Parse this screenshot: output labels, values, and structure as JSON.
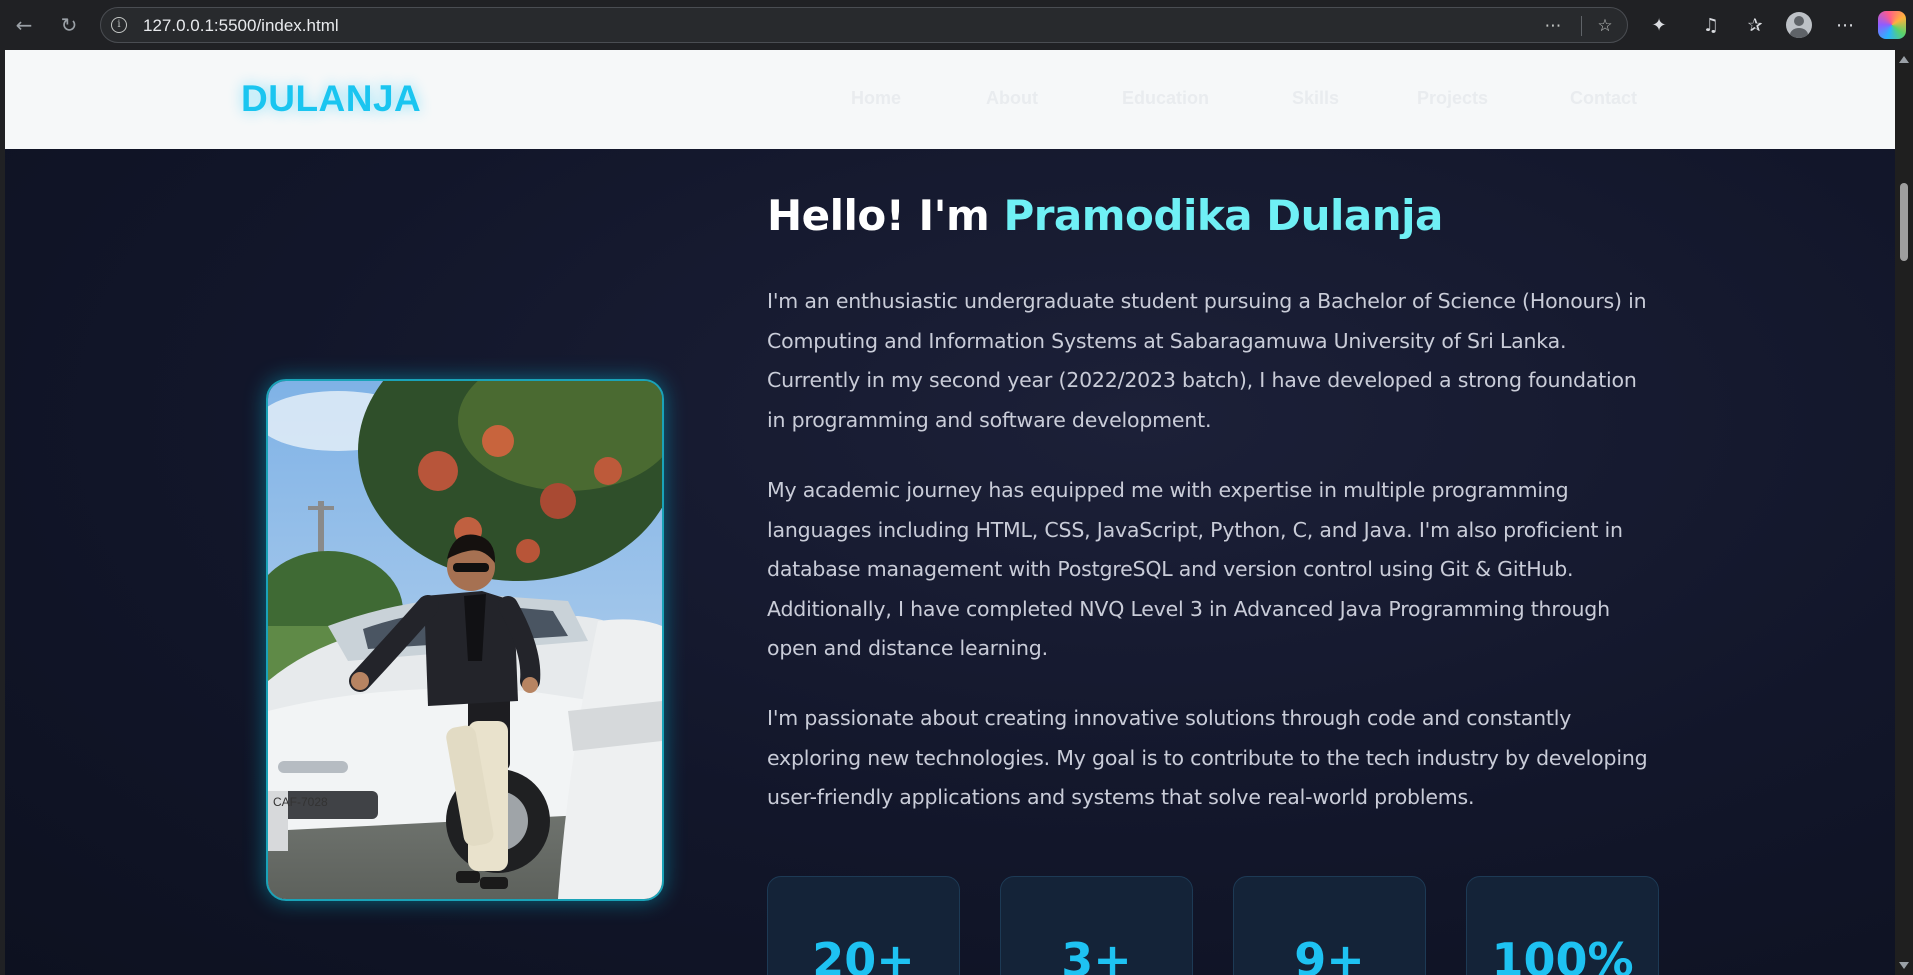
{
  "browser": {
    "url": "127.0.0.1:5500/index.html",
    "icons": [
      "back-arrow-icon",
      "reload-icon",
      "info-icon",
      "reader-icon",
      "favorite-star-icon",
      "extensions-icon",
      "media-icon",
      "favorites-icon",
      "profile-icon",
      "more-icon",
      "copilot-icon"
    ]
  },
  "site": {
    "logo": "DULANJA",
    "nav": [
      "Home",
      "About",
      "Education",
      "Skills",
      "Projects",
      "Contact"
    ],
    "colors": {
      "accent": "#1ac5f0",
      "name": "#6ff0f5",
      "background": "#12162a"
    }
  },
  "about": {
    "greeting": "Hello! I'm ",
    "name": "Pramodika Dulanja",
    "paragraphs": [
      "I'm an enthusiastic undergraduate student pursuing a Bachelor of Science (Honours) in Computing and Information Systems at Sabaragamuwa University of Sri Lanka. Currently in my second year (2022/2023 batch), I have developed a strong foundation in programming and software development.",
      "My academic journey has equipped me with expertise in multiple programming languages including HTML, CSS, JavaScript, Python, C, and Java. I'm also proficient in database management with PostgreSQL and version control using Git & GitHub. Additionally, I have completed NVQ Level 3 in Advanced Java Programming through open and distance learning.",
      "I'm passionate about creating innovative solutions through code and constantly exploring new technologies. My goal is to contribute to the tech industry by developing user-friendly applications and systems that solve real-world problems."
    ],
    "stats": [
      "20+",
      "3+",
      "9+",
      "100%"
    ]
  }
}
